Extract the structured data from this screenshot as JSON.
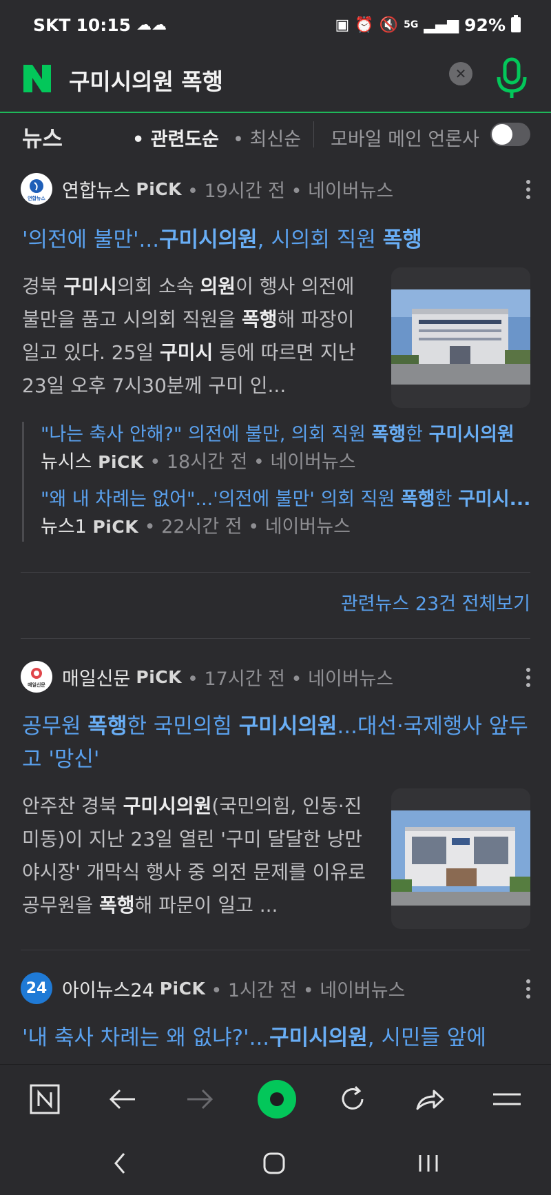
{
  "status_bar": {
    "carrier": "SKT",
    "time": "10:15",
    "network": "5G",
    "battery": "92%"
  },
  "search": {
    "query": "구미시의원 폭행",
    "logo": "N"
  },
  "tabs": {
    "news_label": "뉴스",
    "sort_relevance": "• 관련도순",
    "sort_latest": "• 최신순",
    "mobile_main_label": "모바일 메인 언론사"
  },
  "articles": [
    {
      "press": "연합뉴스",
      "press_logo_text": "연합뉴스",
      "pick": "PiCK",
      "meta": " • 19시간 전 • 네이버뉴스",
      "headline_parts": [
        "'의전에 불만'...",
        "구미시의원",
        ", 시의회 직원 ",
        "폭행"
      ],
      "summary_parts": [
        "경북 ",
        "구미시",
        "의회 소속 ",
        "의원",
        "이 행사 의전에 불만을 품고 시의회 직원을 ",
        "폭행",
        "해 파장이 일고 있다. 25일 ",
        "구미시",
        " 등에 따르면 지난 23일 오후 7시30분께 구미 인..."
      ],
      "related": [
        {
          "title_parts": [
            "\"나는 축사 안해?\" 의전에 불만, 의회 직원 ",
            "폭행",
            "한 ",
            "구미시의원"
          ],
          "press": "뉴시스",
          "pick": "PiCK",
          "meta": " • 18시간 전 • 네이버뉴스"
        },
        {
          "title_parts": [
            "\"왜 내 차례는 없어\"...'의전에 불만' 의회 직원 ",
            "폭행",
            "한 ",
            "구미시..."
          ],
          "press": "뉴스1",
          "pick": "PiCK",
          "meta": " • 22시간 전 • 네이버뉴스"
        }
      ],
      "view_all": "관련뉴스 23건 전체보기"
    },
    {
      "press": "매일신문",
      "press_logo_text": "매일신문",
      "pick": "PiCK",
      "meta": " • 17시간 전 • 네이버뉴스",
      "headline_parts": [
        "공무원 ",
        "폭행",
        "한 국민의힘 ",
        "구미시의원",
        "...대선·국제행사 앞두고 '망신'"
      ],
      "summary_parts": [
        "안주찬 경북 ",
        "구미시의원",
        "(국민의힘, 인동·진미동)이 지난 23일 열린 '구미 달달한 낭만 야시장' 개막식 행사 중 의전 문제를 이유로 공무원을 ",
        "폭행",
        "해 파문이 일고 ..."
      ]
    },
    {
      "press": "아이뉴스24",
      "press_logo_text": "24",
      "pick": "PiCK",
      "meta": " • 1시간 전 • 네이버뉴스",
      "headline_parts": [
        "'내 축사 차례는 왜 없냐?'...",
        "구미시의원",
        ", 시민들 앞에 "
      ]
    }
  ],
  "colors": {
    "background": "#2b2b2e",
    "link": "#5aa1ee",
    "naver_green": "#03c75a",
    "accent_line": "#1fb85a"
  },
  "toolbar_icons": [
    "naver-home-icon",
    "back-arrow-icon",
    "forward-arrow-icon",
    "green-dot-icon",
    "refresh-icon",
    "share-icon",
    "menu-icon"
  ],
  "nav_icons": [
    "system-back-icon",
    "system-home-icon",
    "system-recents-icon"
  ]
}
